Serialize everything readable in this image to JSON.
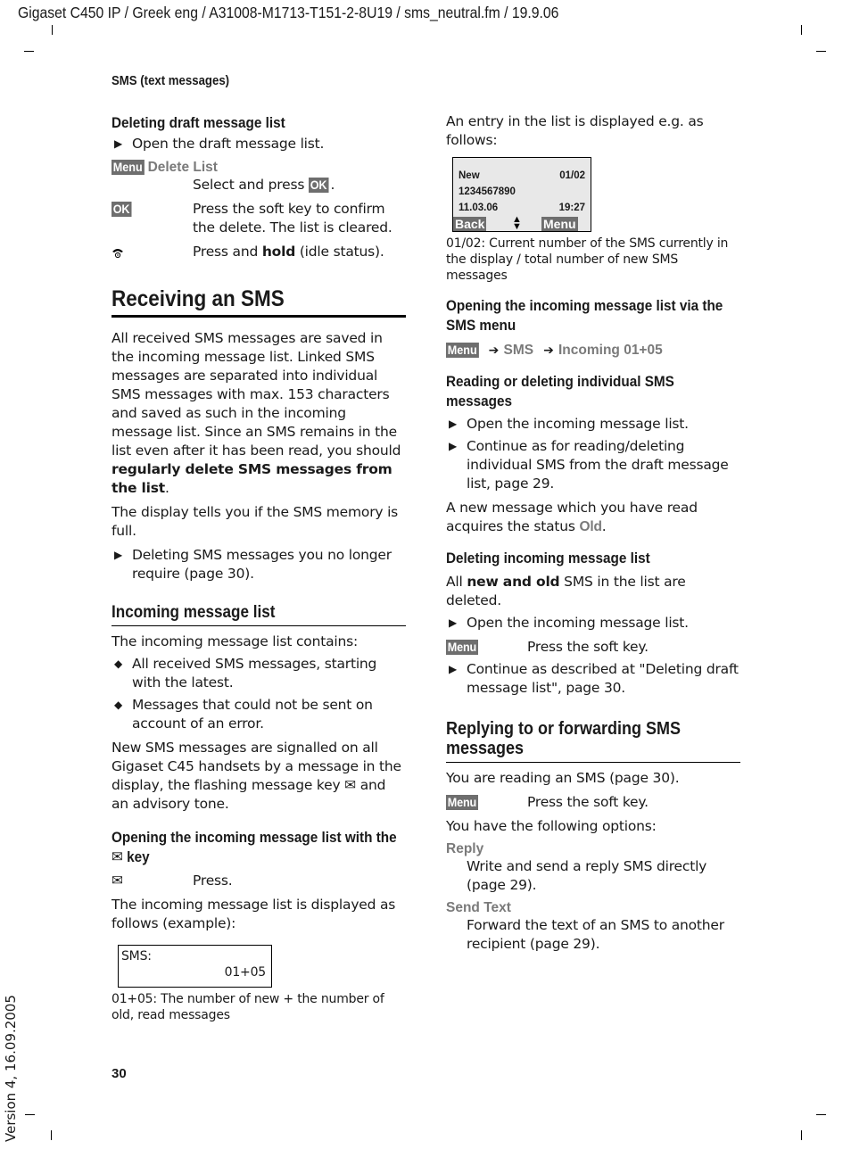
{
  "doc_header": "Gigaset C450 IP / Greek eng / A31008-M1713-T151-2-8U19 / sms_neutral.fm / 19.9.06",
  "running_head": "SMS (text messages)",
  "page_number": "30",
  "version_note": "Version 4, 16.09.2005",
  "soft_key_color": "#6e6e6e",
  "menu_text_color": "#7a7a7a",
  "left": {
    "deleting_draft": {
      "heading": "Deleting draft message list",
      "bullet": "Open the draft message list.",
      "menu_key": "Menu",
      "menu_item": "Delete List",
      "select_text_pre": "Select and press ",
      "ok_key": "OK",
      "select_text_post": ".",
      "ok_step_key": "OK",
      "ok_step_text": "Press the soft key to confirm the delete. The list is cleared.",
      "end_call_icon": "end-call-icon",
      "end_step_pre": "Press and ",
      "end_step_bold": "hold",
      "end_step_post": " (idle status)."
    },
    "receiving": {
      "heading": "Receiving an SMS",
      "para1": "All received SMS messages are saved in the incoming message list. Linked SMS messages are separated into individual SMS messages with max. 153 characters and saved as such in the incoming message list. Since an SMS remains in the list even after it has been read, you should ",
      "para1_bold": "regularly delete SMS messages from the list",
      "para1_end": ".",
      "para2": "The display tells you if the SMS memory is full.",
      "bullet": "Deleting SMS messages you no longer require (page 30)."
    },
    "incoming_list": {
      "heading": "Incoming message list",
      "intro": "The incoming message list contains:",
      "items": [
        "All received SMS messages, starting with the latest.",
        "Messages that could not be sent on account of an error."
      ],
      "para_pre": "New SMS messages are signalled on all Gigaset C45 handsets by a message in the display, the flashing message key ",
      "para_post": " and an advisory tone."
    },
    "opening_with_key": {
      "heading_pre": "Opening the incoming message list with the ",
      "heading_post": " key",
      "step_text": "Press.",
      "para": "The incoming message list is displayed as follows (example):",
      "display": {
        "label": "SMS:",
        "value": "01+05"
      },
      "caption": "01+05: The number of new + the number of old, read messages"
    }
  },
  "right": {
    "entry_intro": "An entry in the list is displayed e.g. as follows:",
    "entry_display": {
      "status": "New",
      "counter": "01/02",
      "number": "1234567890",
      "date": "11.03.06",
      "time": "19:27",
      "left_soft_key": "Back",
      "right_soft_key": "Menu"
    },
    "entry_caption": "01/02: Current number of the SMS currently in the display / total number of new SMS messages",
    "via_menu": {
      "heading": "Opening the incoming message list via the SMS menu",
      "path": [
        "Menu",
        "SMS",
        "Incoming 01+05"
      ]
    },
    "reading_deleting": {
      "heading": "Reading or deleting individual SMS messages",
      "bullets": [
        "Open the incoming message list.",
        "Continue as for reading/deleting individual SMS from the draft message list, page 29."
      ],
      "para_pre": "A new message which you have read acquires the status ",
      "status_old": "Old",
      "para_post": "."
    },
    "deleting_incoming": {
      "heading": "Deleting incoming message list",
      "para_pre": "All ",
      "para_bold": "new and old",
      "para_post": " SMS in the list are deleted.",
      "bullet1": "Open the incoming message list.",
      "menu_key": "Menu",
      "menu_step": "Press the soft key.",
      "bullet2": "Continue as described at \"Deleting draft message list\", page 30."
    },
    "replying": {
      "heading": "Replying to or forwarding SMS messages",
      "para1": "You are reading an SMS (page 30).",
      "menu_key": "Menu",
      "menu_step": "Press the soft key.",
      "para2": "You have the following options:",
      "options": [
        {
          "label": "Reply",
          "desc": "Write and send a reply SMS directly (page 29)."
        },
        {
          "label": "Send Text",
          "desc": "Forward the text of an SMS to another recipient (page 29)."
        }
      ]
    }
  }
}
